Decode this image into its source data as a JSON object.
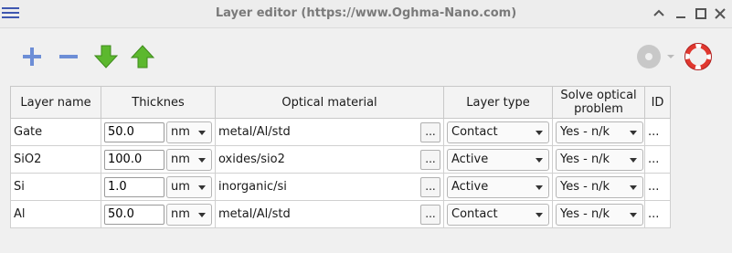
{
  "window": {
    "title": "Layer editor (https://www.Oghma-Nano.com)"
  },
  "toolbar": {
    "add": "add-layer",
    "remove": "remove-layer",
    "move_down": "move-down",
    "move_up": "move-up",
    "help": "help"
  },
  "table": {
    "columns": [
      "Layer name",
      "Thicknes",
      "Optical material",
      "Layer type",
      "Solve optical problem",
      "ID"
    ],
    "rows": [
      {
        "name": "Gate",
        "thickness": "50.0",
        "unit": "nm",
        "material": "metal/Al/std",
        "type": "Contact",
        "solve": "Yes - n/k",
        "id": "..."
      },
      {
        "name": "SiO2",
        "thickness": "100.0",
        "unit": "nm",
        "material": "oxides/sio2",
        "type": "Active",
        "solve": "Yes - n/k",
        "id": "..."
      },
      {
        "name": "Si",
        "thickness": "1.0",
        "unit": "um",
        "material": "inorganic/si",
        "type": "Active",
        "solve": "Yes - n/k",
        "id": "..."
      },
      {
        "name": "Al",
        "thickness": "50.0",
        "unit": "nm",
        "material": "metal/Al/std",
        "type": "Contact",
        "solve": "Yes - n/k",
        "id": "..."
      }
    ],
    "browse_label": "..."
  },
  "colors": {
    "accent": "#3e57b0",
    "arrow_green": "#4caf2a",
    "help_red": "#e0382f"
  }
}
